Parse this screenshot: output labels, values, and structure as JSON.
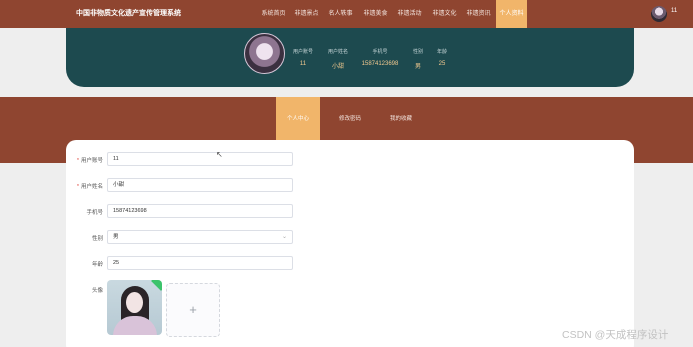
{
  "header": {
    "title": "中国非物质文化遗产宣传管理系统",
    "nav": [
      {
        "label": "系统首页",
        "active": false
      },
      {
        "label": "非遗景点",
        "active": false
      },
      {
        "label": "名人轶事",
        "active": false
      },
      {
        "label": "非遗美食",
        "active": false
      },
      {
        "label": "非遗活动",
        "active": false
      },
      {
        "label": "非遗文化",
        "active": false
      },
      {
        "label": "非遗资讯",
        "active": false
      },
      {
        "label": "个人资料",
        "active": true
      }
    ],
    "user_name": "11",
    "avatar_icon": "user-avatar"
  },
  "profile": {
    "stats": [
      {
        "label": "用户账号",
        "value": "11"
      },
      {
        "label": "用户姓名",
        "value": "小甜"
      },
      {
        "label": "手机号",
        "value": "15874123698"
      },
      {
        "label": "性别",
        "value": "男"
      },
      {
        "label": "年龄",
        "value": "25"
      }
    ]
  },
  "tabs": [
    {
      "label": "个人中心",
      "active": true
    },
    {
      "label": "修改密码",
      "active": false
    },
    {
      "label": "我的收藏",
      "active": false
    }
  ],
  "form": {
    "username": {
      "label": "用户账号",
      "value": "11",
      "required": true
    },
    "realname": {
      "label": "用户姓名",
      "value": "小甜",
      "required": true
    },
    "phone": {
      "label": "手机号",
      "value": "15874123698",
      "required": false
    },
    "gender": {
      "label": "性别",
      "value": "男",
      "required": false
    },
    "age": {
      "label": "年龄",
      "value": "25",
      "required": false
    },
    "avatar": {
      "label": "头像",
      "upload_symbol": "+"
    }
  },
  "watermark": "CSDN @天成程序设计",
  "colors": {
    "nav_bg": "#8f4530",
    "accent": "#f1b56a",
    "banner_bg": "#1d4a4f",
    "stat_value": "#f2c98f",
    "required_mark": "#e0463c"
  }
}
